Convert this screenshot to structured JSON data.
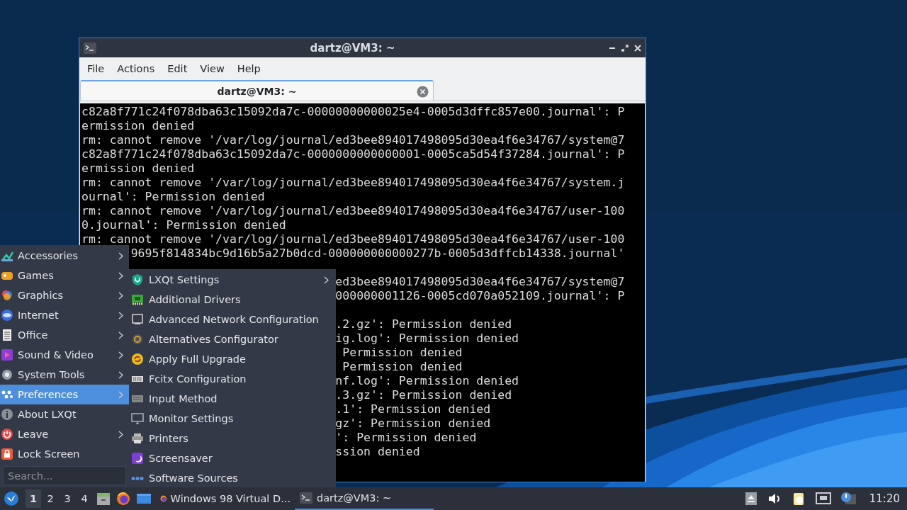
{
  "terminal": {
    "title": "dartz@VM3: ~",
    "menu": [
      "File",
      "Actions",
      "Edit",
      "View",
      "Help"
    ],
    "tabs": [
      {
        "label": "dartz@VM3: ~",
        "selected": true
      }
    ],
    "lines": [
      {
        "kind": "full",
        "text": "c82a8f771c24f078dba63c15092da7c-00000000000025e4-0005d3dffc857e00.journal': P"
      },
      {
        "kind": "full",
        "text": "ermission denied"
      },
      {
        "kind": "full",
        "text": "rm: cannot remove '/var/log/journal/ed3bee894017498095d30ea4f6e34767/system@7"
      },
      {
        "kind": "full",
        "text": "c82a8f771c24f078dba63c15092da7c-0000000000000001-0005ca5d54f37284.journal': P"
      },
      {
        "kind": "full",
        "text": "ermission denied"
      },
      {
        "kind": "full",
        "text": "rm: cannot remove '/var/log/journal/ed3bee894017498095d30ea4f6e34767/system.j"
      },
      {
        "kind": "full",
        "text": "ournal': Permission denied"
      },
      {
        "kind": "full",
        "text": "rm: cannot remove '/var/log/journal/ed3bee894017498095d30ea4f6e34767/user-100"
      },
      {
        "kind": "full",
        "text": "0.journal': Permission denied"
      },
      {
        "kind": "full",
        "text": "rm: cannot remove '/var/log/journal/ed3bee894017498095d30ea4f6e34767/user-100"
      },
      {
        "kind": "past_menu",
        "text": "9695f814834bc9d16b5a27b0dcd-000000000000277b-0005d3dffcb14338.journal'"
      },
      {
        "kind": "past_submenu_gap",
        "text": "ed3bee894017498095d30ea4f6e34767/system@7"
      },
      {
        "kind": "past_submenu",
        "text": "000000001126-0005cd070a052109.journal': P"
      },
      {
        "kind": "past_submenu_gap",
        "text": ".2.gz': Permission denied"
      },
      {
        "kind": "past_submenu",
        "text": "ig.log': Permission denied"
      },
      {
        "kind": "past_submenu",
        "text": " Permission denied"
      },
      {
        "kind": "past_submenu",
        "text": " Permission denied"
      },
      {
        "kind": "past_submenu",
        "text": "nf.log': Permission denied"
      },
      {
        "kind": "past_submenu",
        "text": ".3.gz': Permission denied"
      },
      {
        "kind": "past_submenu",
        "text": ".1': Permission denied"
      },
      {
        "kind": "past_submenu",
        "text": "gz': Permission denied"
      },
      {
        "kind": "past_submenu",
        "text": "': Permission denied"
      },
      {
        "kind": "past_submenu",
        "text": "ssion denied"
      }
    ]
  },
  "main_menu": {
    "items": [
      {
        "label": "Accessories",
        "submenu": true,
        "selected": false
      },
      {
        "label": "Games",
        "submenu": true,
        "selected": false
      },
      {
        "label": "Graphics",
        "submenu": true,
        "selected": false
      },
      {
        "label": "Internet",
        "submenu": true,
        "selected": false
      },
      {
        "label": "Office",
        "submenu": true,
        "selected": false
      },
      {
        "label": "Sound & Video",
        "submenu": true,
        "selected": false
      },
      {
        "label": "System Tools",
        "submenu": true,
        "selected": false
      },
      {
        "label": "Preferences",
        "submenu": true,
        "selected": true
      },
      {
        "label": "About LXQt",
        "submenu": false,
        "selected": false
      },
      {
        "label": "Leave",
        "submenu": true,
        "selected": false
      },
      {
        "label": "Lock Screen",
        "submenu": false,
        "selected": false
      }
    ],
    "search": {
      "placeholder": "Search..."
    }
  },
  "submenu": {
    "items": [
      {
        "label": "LXQt Settings",
        "submenu": true
      },
      {
        "label": "Additional Drivers",
        "submenu": false
      },
      {
        "label": "Advanced Network Configuration",
        "submenu": false
      },
      {
        "label": "Alternatives Configurator",
        "submenu": false
      },
      {
        "label": "Apply Full Upgrade",
        "submenu": false
      },
      {
        "label": "Fcitx Configuration",
        "submenu": false
      },
      {
        "label": "Input Method",
        "submenu": false
      },
      {
        "label": "Monitor Settings",
        "submenu": false
      },
      {
        "label": "Printers",
        "submenu": false
      },
      {
        "label": "Screensaver",
        "submenu": false
      },
      {
        "label": "Software Sources",
        "submenu": false
      }
    ]
  },
  "taskbar": {
    "desktops": [
      {
        "label": "1",
        "selected": true
      },
      {
        "label": "2",
        "selected": false
      },
      {
        "label": "3",
        "selected": false
      },
      {
        "label": "4",
        "selected": false
      }
    ],
    "tasks": [
      {
        "label": "Windows 98 Virtual D...",
        "selected": false
      },
      {
        "label": "dartz@VM3: ~",
        "selected": true
      }
    ],
    "clock": "11:20"
  }
}
